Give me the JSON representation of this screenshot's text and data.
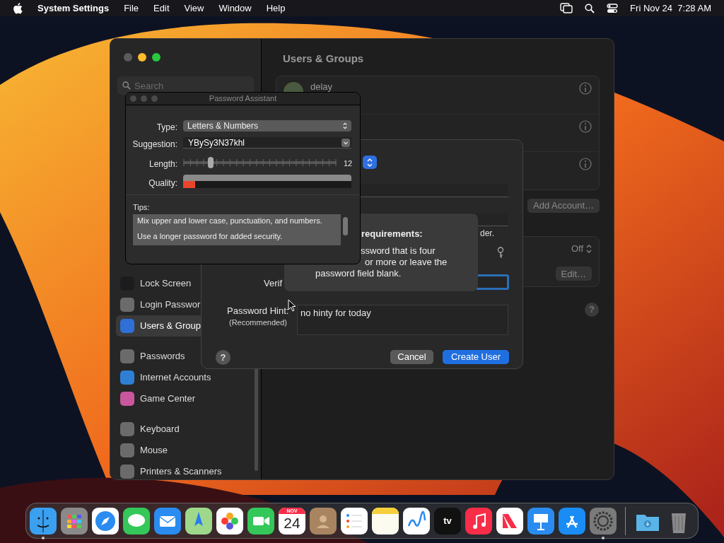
{
  "menu_bar": {
    "app_name": "System Settings",
    "menus": [
      "File",
      "Edit",
      "View",
      "Window",
      "Help"
    ],
    "clock": "Fri Nov 24  7:28 AM"
  },
  "settings_window": {
    "title": "Users & Groups",
    "search_placeholder": "Search",
    "sidebar_groups": [
      {
        "items": [
          {
            "label": "Lock Screen",
            "selected": false,
            "color": "#1c1c1e"
          },
          {
            "label": "Login Passwor",
            "selected": false,
            "color": "#6b6b6b"
          },
          {
            "label": "Users & Group",
            "selected": true,
            "color": "#2f6fd6"
          }
        ]
      },
      {
        "items": [
          {
            "label": "Passwords",
            "selected": false,
            "color": "#6b6b6b"
          },
          {
            "label": "Internet Accounts",
            "selected": false,
            "color": "#2f7fd6"
          },
          {
            "label": "Game Center",
            "selected": false,
            "color": "#c9579e"
          }
        ]
      },
      {
        "items": [
          {
            "label": "Keyboard",
            "selected": false,
            "color": "#6b6b6b"
          },
          {
            "label": "Mouse",
            "selected": false,
            "color": "#6b6b6b"
          },
          {
            "label": "Printers & Scanners",
            "selected": false,
            "color": "#6b6b6b"
          }
        ]
      }
    ],
    "users": [
      {
        "name": "delay"
      }
    ],
    "add_account_button": "Add Account…",
    "auto_login_value": "Off",
    "edit_button": "Edit…",
    "help_button": "?"
  },
  "new_user_dialog": {
    "fragment": "der.",
    "verify_label": "Verif",
    "hint_label": "Password Hint:",
    "hint_note": "(Recommended)",
    "hint_value": "no hinty for today",
    "help_button": "?",
    "cancel_button": "Cancel",
    "create_button": "Create User"
  },
  "tooltip": {
    "heading": "requirements:",
    "lines": [
      "ssword that is four",
      "or more or leave the",
      "password field blank."
    ]
  },
  "password_assistant": {
    "title": "Password Assistant",
    "type_label": "Type:",
    "type_value": "Letters & Numbers",
    "suggestion_label": "Suggestion:",
    "suggestion_value": "YBySy3N37khl",
    "length_label": "Length:",
    "length": {
      "level": 0.18
    },
    "length_value": "12",
    "quality_label": "Quality:",
    "quality": {
      "level": 0.07
    },
    "tips_label": "Tips:",
    "tips": [
      "Mix upper and lower case, punctuation, and numbers.",
      "Use a longer password for added security."
    ]
  },
  "dock": {
    "apps": [
      {
        "kind": "finder",
        "running": true
      },
      {
        "kind": "launchpad",
        "running": false
      },
      {
        "kind": "safari",
        "running": false
      },
      {
        "kind": "messages",
        "running": false
      },
      {
        "kind": "mail",
        "running": false
      },
      {
        "kind": "maps",
        "running": false
      },
      {
        "kind": "photos",
        "running": false
      },
      {
        "kind": "facetime",
        "running": false
      },
      {
        "kind": "calendar",
        "running": false,
        "month": "NOV",
        "day": "24"
      },
      {
        "kind": "contacts",
        "running": false
      },
      {
        "kind": "reminders",
        "running": false
      },
      {
        "kind": "notes",
        "running": false
      },
      {
        "kind": "freeform",
        "running": false
      },
      {
        "kind": "tv",
        "running": false,
        "text": "tv"
      },
      {
        "kind": "music",
        "running": false
      },
      {
        "kind": "news",
        "running": false
      },
      {
        "kind": "keynote",
        "running": false
      },
      {
        "kind": "appstore",
        "running": false
      },
      {
        "kind": "settings",
        "running": true
      }
    ],
    "stacks": [
      {
        "kind": "downloads"
      },
      {
        "kind": "trash"
      }
    ]
  }
}
